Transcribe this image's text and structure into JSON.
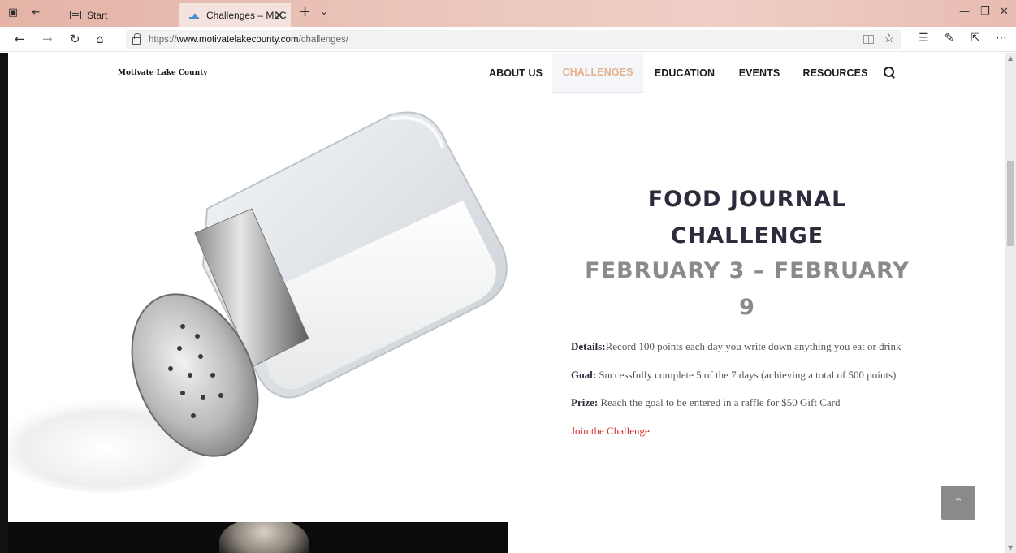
{
  "browser": {
    "tabs": [
      {
        "label": "Start"
      },
      {
        "label": "Challenges – MLC"
      }
    ],
    "url_prefix": "https://",
    "url_domain": "www.motivatelakecounty.com",
    "url_path": "/challenges/"
  },
  "site": {
    "logo": "Motivate Lake County",
    "menu": [
      "ABOUT US",
      "CHALLENGES",
      "EDUCATION",
      "EVENTS",
      "RESOURCES"
    ],
    "active_menu": "CHALLENGES"
  },
  "challenge": {
    "title_line1": "FOOD JOURNAL",
    "title_line2": "CHALLENGE",
    "date_line1": "FEBRUARY 3 – FEBRUARY",
    "date_line2": "9",
    "details_label": "Details:",
    "details_text": "Record 100 points each day you write down anything you eat or drink",
    "goal_label": "Goal:",
    "goal_text": " Successfully complete 5 of the 7 days (achieving a total of 500 points)",
    "prize_label": "Prize:",
    "prize_text": " Reach the goal to be entered in a raffle for $50 Gift Card",
    "join_link": "Join the Challenge"
  },
  "colors": {
    "title": "#2e2b3c",
    "date": "#8a8a8a",
    "active_menu": "#e6b18f",
    "join_link": "#d62c2c",
    "tabbar": "#e8bcb1"
  }
}
